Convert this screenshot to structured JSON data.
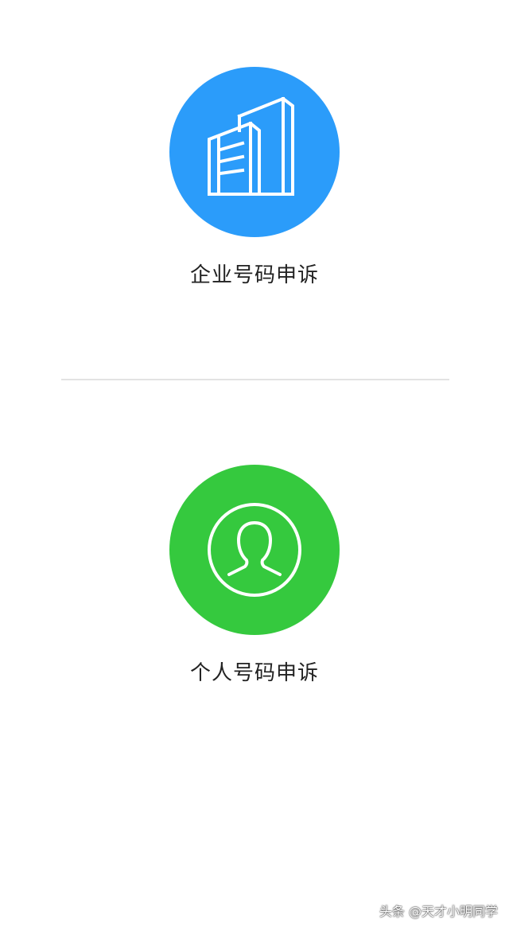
{
  "options": {
    "enterprise": {
      "label": "企业号码申诉",
      "icon": "building-icon",
      "color": "#2b9cfa"
    },
    "personal": {
      "label": "个人号码申诉",
      "icon": "person-icon",
      "color": "#35c93e"
    }
  },
  "watermark": "头条 @天才小明同学"
}
